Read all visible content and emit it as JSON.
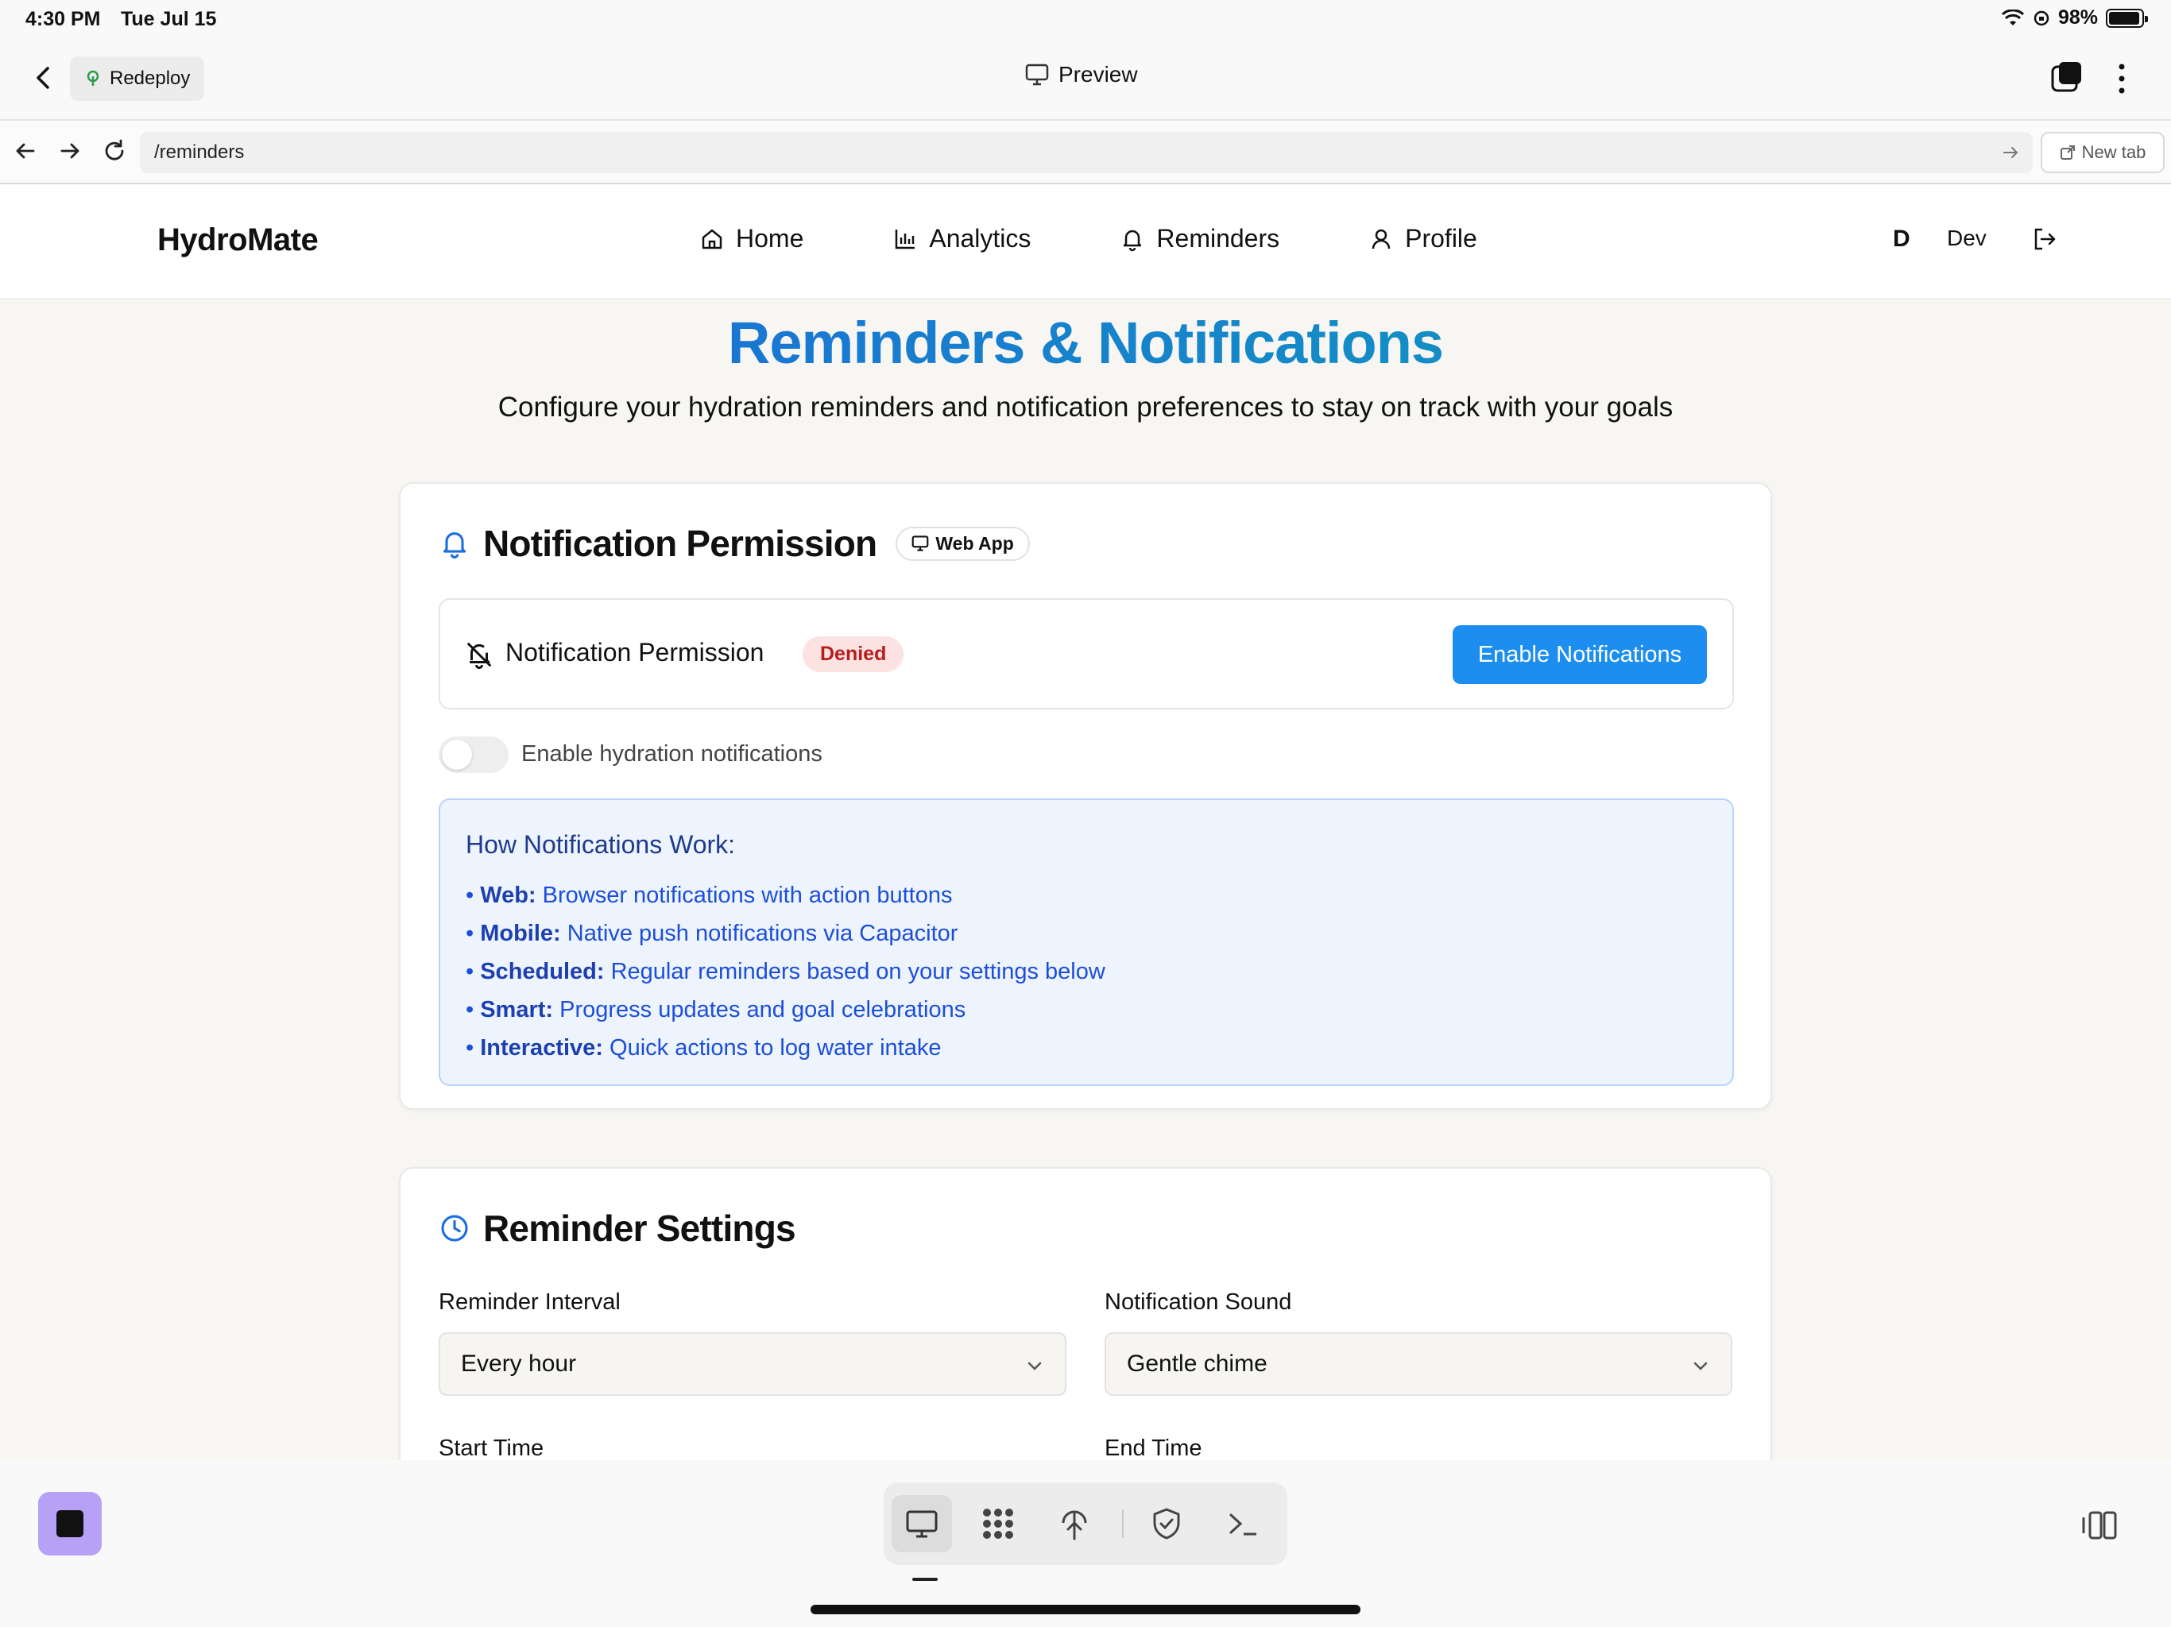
{
  "status_bar": {
    "time": "4:30 PM",
    "date": "Tue Jul 15",
    "battery": "98%"
  },
  "top_bar": {
    "redeploy_label": "Redeploy",
    "preview_label": "Preview"
  },
  "url_bar": {
    "url": "/reminders",
    "new_tab_label": "New tab"
  },
  "app_header": {
    "logo": "HydroMate",
    "nav": [
      {
        "label": "Home",
        "icon": "home-icon"
      },
      {
        "label": "Analytics",
        "icon": "bar-chart-icon"
      },
      {
        "label": "Reminders",
        "icon": "bell-icon"
      },
      {
        "label": "Profile",
        "icon": "user-icon"
      }
    ],
    "user_initial": "D",
    "user_name": "Dev"
  },
  "page": {
    "title": "Reminders & Notifications",
    "subtitle": "Configure your hydration reminders and notification preferences to stay on track with your goals"
  },
  "permission_card": {
    "title": "Notification Permission",
    "platform_badge": "Web App",
    "status_label": "Notification Permission",
    "status_value": "Denied",
    "enable_button": "Enable Notifications",
    "toggle_label": "Enable hydration notifications",
    "toggle_on": false,
    "info_title": "How Notifications Work:",
    "info_items": [
      {
        "term": "Web:",
        "text": "Browser notifications with action buttons"
      },
      {
        "term": "Mobile:",
        "text": "Native push notifications via Capacitor"
      },
      {
        "term": "Scheduled:",
        "text": "Regular reminders based on your settings below"
      },
      {
        "term": "Smart:",
        "text": "Progress updates and goal celebrations"
      },
      {
        "term": "Interactive:",
        "text": "Quick actions to log water intake"
      }
    ]
  },
  "reminder_card": {
    "title": "Reminder Settings",
    "interval_label": "Reminder Interval",
    "interval_value": "Every hour",
    "sound_label": "Notification Sound",
    "sound_value": "Gentle chime",
    "start_label": "Start Time",
    "end_label": "End Time"
  },
  "colors": {
    "accent": "#1d8ef0",
    "title_gradient_start": "#1f5fe0",
    "title_gradient_end": "#0ea5b7",
    "denied_bg": "#fde2e2",
    "denied_text": "#b91c1c",
    "info_bg": "#edf4fe"
  }
}
